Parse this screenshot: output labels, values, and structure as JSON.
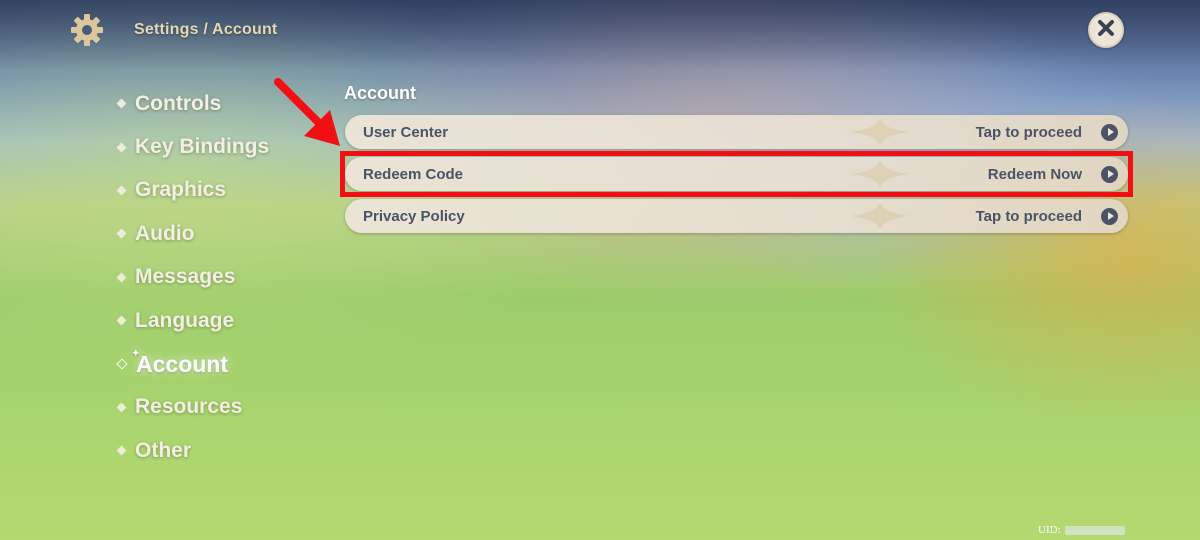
{
  "header": {
    "breadcrumb": "Settings / Account",
    "gear_icon": "gear-icon",
    "close_icon": "close-icon"
  },
  "sidebar": {
    "items": [
      {
        "label": "Controls",
        "active": false
      },
      {
        "label": "Key Bindings",
        "active": false
      },
      {
        "label": "Graphics",
        "active": false
      },
      {
        "label": "Audio",
        "active": false
      },
      {
        "label": "Messages",
        "active": false
      },
      {
        "label": "Language",
        "active": false
      },
      {
        "label": "Account",
        "active": true
      },
      {
        "label": "Resources",
        "active": false
      },
      {
        "label": "Other",
        "active": false
      }
    ]
  },
  "main": {
    "section_title": "Account",
    "rows": [
      {
        "label": "User Center",
        "action": "Tap to proceed"
      },
      {
        "label": "Redeem Code",
        "action": "Redeem Now"
      },
      {
        "label": "Privacy Policy",
        "action": "Tap to proceed"
      }
    ]
  },
  "footer": {
    "uid_label": "UID:"
  },
  "colors": {
    "highlight": "#f20f14",
    "row_bg": "#ece5d8",
    "row_text": "#4b5366",
    "breadcrumb_text": "#e6d7b4"
  }
}
